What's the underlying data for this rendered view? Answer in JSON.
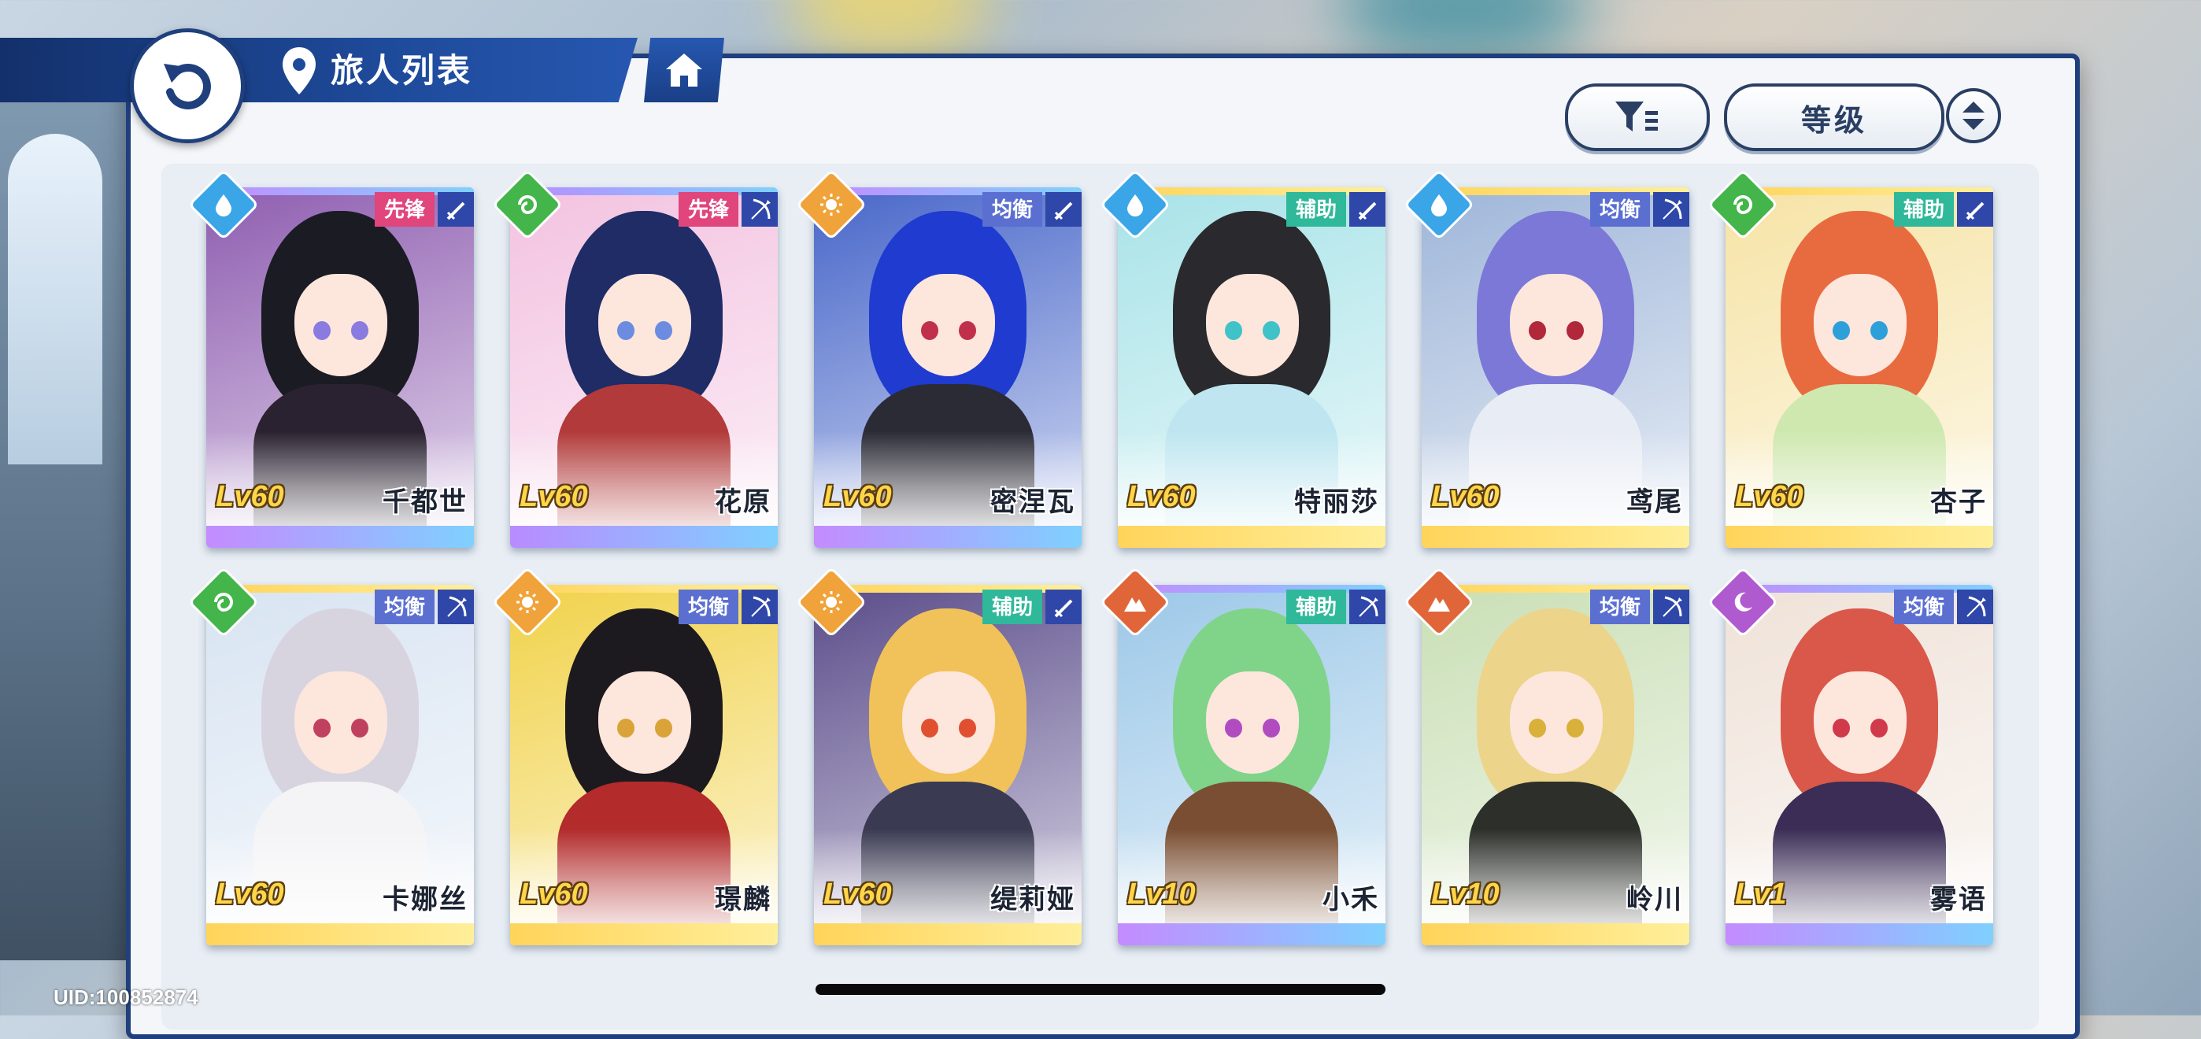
{
  "header": {
    "title": "旅人列表"
  },
  "controls": {
    "sort_label": "等级"
  },
  "uid": "UID:100852874",
  "colors": {
    "header_blue": "#1e4a9a",
    "level_gold": "#ffd54a",
    "role_vanguard": "#e0457b",
    "role_balance": "#5b6fd1",
    "role_support": "#2fb89a"
  },
  "characters": [
    {
      "name": "千都世",
      "level": "Lv60",
      "role": "先锋",
      "role_color": "#e0457b",
      "element": "water-drop-icon",
      "element_color": "#3aa6e8",
      "weapon": "sword-icon",
      "hair": "#1b1b24",
      "eye": "#8a7be0",
      "body": "#2a2230",
      "art_bg": "#8e5db0",
      "strip": "linear-gradient(90deg,#c48bff,#7fd0ff)"
    },
    {
      "name": "花原",
      "level": "Lv60",
      "role": "先锋",
      "role_color": "#e0457b",
      "element": "wind-swirl-icon",
      "element_color": "#43b54a",
      "weapon": "bow-icon",
      "hair": "#1f2c66",
      "eye": "#6b8ce0",
      "body": "#b23a3a",
      "art_bg": "#f3c2e0",
      "strip": "linear-gradient(90deg,#b98bff,#7fd0ff)"
    },
    {
      "name": "密涅瓦",
      "level": "Lv60",
      "role": "均衡",
      "role_color": "#5b6fd1",
      "element": "sun-icon",
      "element_color": "#f0a33a",
      "weapon": "sword-icon",
      "hair": "#1f3bd0",
      "eye": "#c0304a",
      "body": "#2b2b35",
      "art_bg": "#4766c9",
      "strip": "linear-gradient(90deg,#c48bff,#7fd0ff)"
    },
    {
      "name": "特丽莎",
      "level": "Lv60",
      "role": "辅助",
      "role_color": "#2fb89a",
      "element": "water-drop-icon",
      "element_color": "#3aa6e8",
      "weapon": "sword-icon",
      "hair": "#2a2a2e",
      "eye": "#3fc2c8",
      "body": "#bfe6f0",
      "art_bg": "#a8e3e8",
      "strip": "linear-gradient(90deg,#ffd45a,#ffef9a)"
    },
    {
      "name": "鸢尾",
      "level": "Lv60",
      "role": "均衡",
      "role_color": "#5b6fd1",
      "element": "water-drop-icon",
      "element_color": "#3aa6e8",
      "weapon": "bow-icon",
      "hair": "#7c78d8",
      "eye": "#b0283a",
      "body": "#e8ecf4",
      "art_bg": "#9fb6d9",
      "strip": "linear-gradient(90deg,#ffd45a,#ffef9a)"
    },
    {
      "name": "杏子",
      "level": "Lv60",
      "role": "辅助",
      "role_color": "#2fb89a",
      "element": "wind-swirl-icon",
      "element_color": "#43b54a",
      "weapon": "sword-icon",
      "hair": "#e86b3f",
      "eye": "#2ea0d9",
      "body": "#cfe8b0",
      "art_bg": "#f6e3a5",
      "strip": "linear-gradient(90deg,#ffd45a,#ffef9a)"
    },
    {
      "name": "卡娜丝",
      "level": "Lv60",
      "role": "均衡",
      "role_color": "#5b6fd1",
      "element": "wind-swirl-icon",
      "element_color": "#43b54a",
      "weapon": "bow-icon",
      "hair": "#d7d4df",
      "eye": "#c04060",
      "body": "#f4f4f6",
      "art_bg": "#d8e4f2",
      "strip": "linear-gradient(90deg,#ffd45a,#ffef9a)"
    },
    {
      "name": "璟麟",
      "level": "Lv60",
      "role": "均衡",
      "role_color": "#5b6fd1",
      "element": "sun-icon",
      "element_color": "#f0a33a",
      "weapon": "bow-icon",
      "hair": "#1d1a1f",
      "eye": "#d9a33a",
      "body": "#b32b2b",
      "art_bg": "#f1d24a",
      "strip": "linear-gradient(90deg,#ffd45a,#ffef9a)"
    },
    {
      "name": "缇莉娅",
      "level": "Lv60",
      "role": "辅助",
      "role_color": "#2fb89a",
      "element": "sun-icon",
      "element_color": "#f0a33a",
      "weapon": "sword-icon",
      "hair": "#f2c25a",
      "eye": "#e05030",
      "body": "#3a3a52",
      "art_bg": "#5a4c8a",
      "strip": "linear-gradient(90deg,#ffd45a,#ffef9a)"
    },
    {
      "name": "小禾",
      "level": "Lv10",
      "role": "辅助",
      "role_color": "#2fb89a",
      "element": "mountain-icon",
      "element_color": "#e0663a",
      "weapon": "bow-icon",
      "hair": "#7fd48a",
      "eye": "#b04cc0",
      "body": "#7a4e32",
      "art_bg": "#9cc8e8",
      "strip": "linear-gradient(90deg,#c48bff,#7fd0ff)"
    },
    {
      "name": "岭川",
      "level": "Lv10",
      "role": "均衡",
      "role_color": "#5b6fd1",
      "element": "mountain-icon",
      "element_color": "#e0663a",
      "weapon": "bow-icon",
      "hair": "#ecd48a",
      "eye": "#d9b03a",
      "body": "#2c2f2a",
      "art_bg": "#c9dfb5",
      "strip": "linear-gradient(90deg,#ffd45a,#ffef9a)"
    },
    {
      "name": "雾语",
      "level": "Lv1",
      "role": "均衡",
      "role_color": "#5b6fd1",
      "element": "moon-icon",
      "element_color": "#b05ad0",
      "weapon": "bow-icon",
      "hair": "#d9584a",
      "eye": "#d03a4a",
      "body": "#3b2d56",
      "art_bg": "#efe2d8",
      "strip": "linear-gradient(90deg,#c48bff,#7fd0ff)"
    }
  ]
}
